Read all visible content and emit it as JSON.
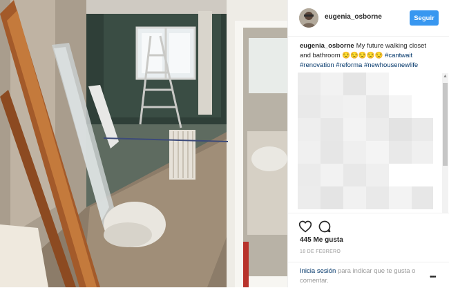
{
  "post": {
    "username": "eugenia_osborne",
    "follow_label": "Seguir",
    "caption": {
      "username": "eugenia_osborne",
      "text": "My future walking closet and bathroom 😒😒😒😒😒",
      "hashtags": [
        "#cantwait",
        "#renovation",
        "#reforma",
        "#newhousenewlife"
      ]
    },
    "likes": "445 Me gusta",
    "date": "18 DE FEBRERO",
    "login_link": "Inicia sesión",
    "login_text": "para indicar que te gusta o comentar.",
    "more_label": "•••"
  },
  "icons": {
    "like": "heart-icon",
    "comment": "comment-icon",
    "more": "more-options-icon"
  },
  "colors": {
    "follow_button": "#3897f0",
    "hashtag": "#003569",
    "secondary_text": "#999999"
  }
}
